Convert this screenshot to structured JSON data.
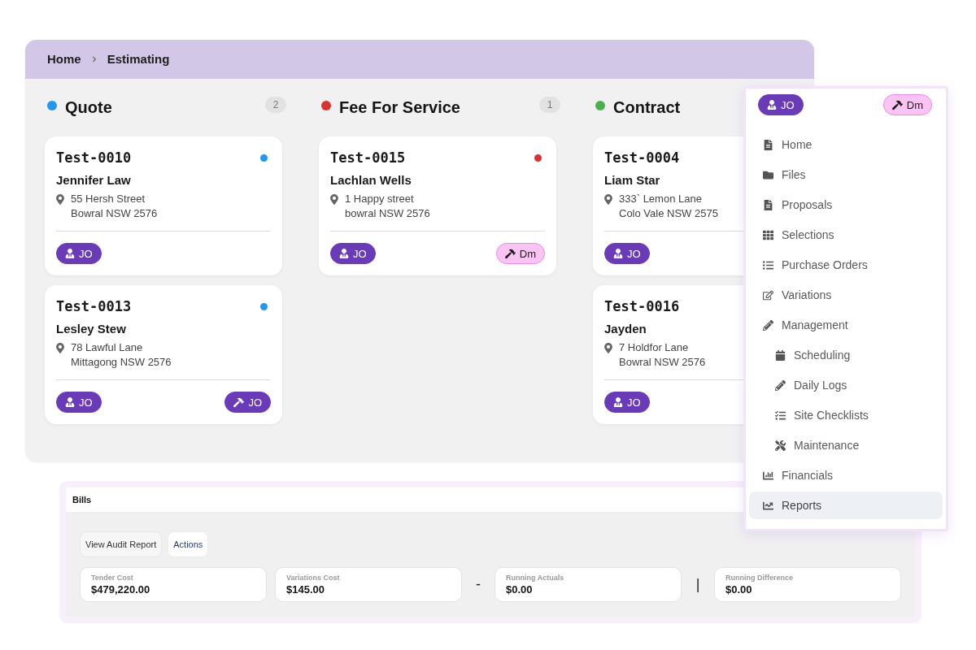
{
  "breadcrumb": [
    {
      "label": "Home"
    },
    {
      "label": "Estimating"
    }
  ],
  "columns": [
    {
      "title": "Quote",
      "color": "#2196f3",
      "count": "2",
      "cards": [
        {
          "code": "Test-0010",
          "color": "#2196f3",
          "name": "Jennifer Law",
          "address": [
            "55 Hersh Street",
            "Bowral NSW 2576"
          ],
          "badges": [
            {
              "kind": "client",
              "label": "JO",
              "color": "#6a3bb8"
            }
          ]
        },
        {
          "code": "Test-0013",
          "color": "#2196f3",
          "name": "Lesley Stew",
          "address": [
            "78 Lawful Lane",
            "Mittagong NSW 2576"
          ],
          "badges": [
            {
              "kind": "client",
              "label": "JO",
              "color": "#6a3bb8"
            },
            {
              "kind": "builder",
              "label": "JO",
              "color": "#6a3bb8"
            }
          ]
        }
      ]
    },
    {
      "title": "Fee For Service",
      "color": "#d93232",
      "count": "1",
      "cards": [
        {
          "code": "Test-0015",
          "color": "#d93232",
          "name": "Lachlan Wells",
          "address": [
            "1 Happy street",
            "bowral NSW 2576"
          ],
          "badges": [
            {
              "kind": "client",
              "label": "JO",
              "color": "#6a3bb8"
            },
            {
              "kind": "builder",
              "label": "Dm",
              "color": "#f9c4f2"
            }
          ]
        }
      ]
    },
    {
      "title": "Contract",
      "color": "#4caf50",
      "cards": [
        {
          "code": "Test-0004",
          "name": "Liam Star",
          "address": [
            "333` Lemon Lane",
            "Colo Vale NSW 2575"
          ],
          "badges": [
            {
              "kind": "client",
              "label": "JO",
              "color": "#6a3bb8"
            }
          ]
        },
        {
          "code": "Test-0016",
          "name": "Jayden",
          "address": [
            "7 Holdfor Lane",
            "Bowral NSW 2576"
          ],
          "badges": [
            {
              "kind": "client",
              "label": "JO",
              "color": "#6a3bb8"
            }
          ]
        }
      ]
    }
  ],
  "user_menu": {
    "badges": [
      {
        "kind": "client",
        "label": "JO",
        "color": "#6a3bb8"
      },
      {
        "kind": "builder",
        "label": "Dm",
        "color": "#f9c4f2"
      }
    ],
    "items": [
      {
        "label": "Home",
        "selected": false
      },
      {
        "label": "Files",
        "selected": false
      },
      {
        "label": "Proposals",
        "selected": false
      },
      {
        "label": "Selections",
        "selected": false
      },
      {
        "label": "Purchase Orders",
        "selected": false
      },
      {
        "label": "Variations",
        "selected": false
      },
      {
        "label": "Management",
        "selected": false,
        "children": [
          {
            "label": "Scheduling",
            "selected": false
          },
          {
            "label": "Daily Logs",
            "selected": false
          },
          {
            "label": "Site Checklists",
            "selected": false
          },
          {
            "label": "Maintenance",
            "selected": false
          }
        ]
      },
      {
        "label": "Financials",
        "selected": false
      },
      {
        "label": "Reports",
        "selected": true
      }
    ]
  },
  "bills": {
    "title": "Bills",
    "buttons": [
      {
        "label": "View Audit Report",
        "kind": "secondary"
      },
      {
        "label": "Actions",
        "kind": "accent"
      }
    ],
    "summary": [
      {
        "kind": "stat",
        "label": "Tender Cost",
        "value": "$479,220.00"
      },
      {
        "kind": "stat",
        "label": "Variations Cost",
        "value": "$145.00"
      },
      {
        "kind": "operator",
        "symbol": "-"
      },
      {
        "kind": "stat",
        "label": "Running Actuals",
        "value": "$0.00"
      },
      {
        "kind": "operator",
        "symbol": "|"
      },
      {
        "kind": "stat",
        "label": "Running Difference",
        "value": "$0.00"
      }
    ]
  }
}
